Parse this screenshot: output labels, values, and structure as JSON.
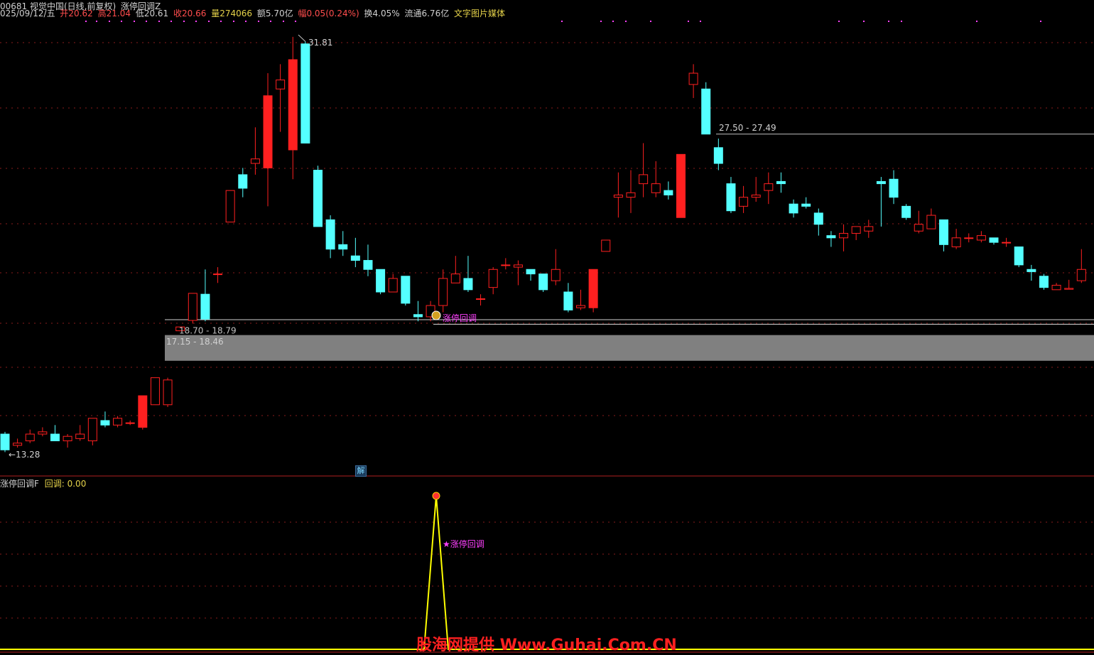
{
  "header": {
    "code_title": "00681 视觉中国(日线,前复权)",
    "indicator_name": "涨停回调Z",
    "date": "025/09/12/五",
    "open_label": "开",
    "open": "20.62",
    "high_label": "高",
    "high": "21.04",
    "low_label": "低",
    "low": "20.61",
    "close_label": "收",
    "close": "20.66",
    "volume_label": "量",
    "volume": "274066",
    "amount_label": "额",
    "amount": "5.70亿",
    "change_label": "幅",
    "change": "0.05(0.24%)",
    "turnover_label": "换",
    "turnover": "4.05%",
    "float_label": "流通",
    "float": "6.76亿",
    "tags": "文字图片媒体"
  },
  "sub_panel": {
    "name": "涨停回调F",
    "value_label": "回调:",
    "value": "0.00"
  },
  "labels": {
    "zt_pullback": "涨停回调",
    "zt_pullback_star": "★涨停回调",
    "jie": "解",
    "watermark": "股海网提供 Www.Guhai.Com.CN"
  },
  "colors": {
    "up": "#ff2020",
    "down": "#54ffff",
    "grid": "#8a1c1c",
    "zone": "#808080",
    "signal": "#ffff00",
    "magenta": "#ff40ff"
  },
  "chart_data": {
    "type": "candlestick",
    "title": "00681 视觉中国(日线,前复权)",
    "ylim": [
      12.5,
      32.5
    ],
    "annotations": [
      {
        "text": "31.81",
        "value": 31.81,
        "kind": "max"
      },
      {
        "text": "←13.28",
        "value": 13.28,
        "kind": "min"
      },
      {
        "text": "27.50 - 27.49",
        "value": 27.5,
        "kind": "level"
      },
      {
        "text": "18.70 - 18.79",
        "value": 18.79,
        "kind": "zone_top"
      },
      {
        "text": "17.15 - 18.46",
        "value": 18.46,
        "kind": "zone"
      }
    ],
    "zone": [
      17.45,
      18.59
    ],
    "support_line": 19.07,
    "candles": [
      [
        14.2,
        13.5,
        14.3,
        13.4
      ],
      [
        13.7,
        13.8,
        14.0,
        13.6
      ],
      [
        13.9,
        14.2,
        14.4,
        13.8
      ],
      [
        14.2,
        14.3,
        14.5,
        14.1
      ],
      [
        14.2,
        13.9,
        14.6,
        13.9
      ],
      [
        13.9,
        14.1,
        14.2,
        13.6
      ],
      [
        14.0,
        14.2,
        14.6,
        13.9
      ],
      [
        13.9,
        14.9,
        14.9,
        13.7
      ],
      [
        14.8,
        14.6,
        15.2,
        14.5
      ],
      [
        14.6,
        14.9,
        15.0,
        14.5
      ],
      [
        14.7,
        14.7,
        14.8,
        14.6
      ],
      [
        14.5,
        15.9,
        15.9,
        14.4
      ],
      [
        15.5,
        16.7,
        16.7,
        15.5
      ],
      [
        15.5,
        16.6,
        16.7,
        15.4
      ],
      [
        18.78,
        18.95,
        18.95,
        18.76
      ],
      [
        19.24,
        20.44,
        20.44,
        19.1
      ],
      [
        20.4,
        19.3,
        21.5,
        19.2
      ],
      [
        21.3,
        21.3,
        21.6,
        20.9
      ],
      [
        23.6,
        25.0,
        25.0,
        23.6
      ],
      [
        25.7,
        25.1,
        26.0,
        24.7
      ],
      [
        26.2,
        26.4,
        27.8,
        25.7
      ],
      [
        26.0,
        29.2,
        30.2,
        24.3
      ],
      [
        29.5,
        29.9,
        30.6,
        27.6
      ],
      [
        26.8,
        30.8,
        31.81,
        25.5
      ],
      [
        31.5,
        27.1,
        31.6,
        27.1
      ],
      [
        25.9,
        23.4,
        26.1,
        23.4
      ],
      [
        23.7,
        22.4,
        23.9,
        22.0
      ],
      [
        22.6,
        22.4,
        23.2,
        22.1
      ],
      [
        22.1,
        21.9,
        22.9,
        21.6
      ],
      [
        21.9,
        21.5,
        22.6,
        21.2
      ],
      [
        21.5,
        20.5,
        21.5,
        20.4
      ],
      [
        20.5,
        21.1,
        21.3,
        20.5
      ],
      [
        21.2,
        20.0,
        21.2,
        19.9
      ],
      [
        19.5,
        19.4,
        20.1,
        19.2
      ],
      [
        19.4,
        19.9,
        20.1,
        19.2
      ],
      [
        19.9,
        21.1,
        21.5,
        19.6
      ],
      [
        20.9,
        21.3,
        22.1,
        20.9
      ],
      [
        21.1,
        20.6,
        22.1,
        20.5
      ],
      [
        20.2,
        20.2,
        20.4,
        19.9
      ],
      [
        20.7,
        21.5,
        21.6,
        20.4
      ],
      [
        21.7,
        21.7,
        22.0,
        21.5
      ],
      [
        21.6,
        21.7,
        21.9,
        20.8
      ],
      [
        21.5,
        21.3,
        21.5,
        21.0
      ],
      [
        21.3,
        20.6,
        21.3,
        20.5
      ],
      [
        21.0,
        21.5,
        22.4,
        20.8
      ],
      [
        20.5,
        19.7,
        20.9,
        19.6
      ],
      [
        19.8,
        19.9,
        20.6,
        19.7
      ],
      [
        19.8,
        21.5,
        21.5,
        19.6
      ],
      [
        22.3,
        22.8,
        22.8,
        22.4
      ],
      [
        24.7,
        24.8,
        25.8,
        23.8
      ],
      [
        24.7,
        24.9,
        25.9,
        24.0
      ],
      [
        25.3,
        25.7,
        27.1,
        24.7
      ],
      [
        24.9,
        25.3,
        26.3,
        24.7
      ],
      [
        25.0,
        24.8,
        25.4,
        24.6
      ],
      [
        23.8,
        26.6,
        26.6,
        23.8
      ],
      [
        29.7,
        30.2,
        30.6,
        29.1
      ],
      [
        29.5,
        27.5,
        29.8,
        27.5
      ],
      [
        26.9,
        26.2,
        27.3,
        25.9
      ],
      [
        25.3,
        24.1,
        25.6,
        24.0
      ],
      [
        24.3,
        24.7,
        25.2,
        24.0
      ],
      [
        24.7,
        24.8,
        25.6,
        24.5
      ],
      [
        25.0,
        25.3,
        25.8,
        24.4
      ],
      [
        25.4,
        25.3,
        25.8,
        24.9
      ],
      [
        24.4,
        24.0,
        24.6,
        23.8
      ],
      [
        24.4,
        24.3,
        24.7,
        24.2
      ],
      [
        24.0,
        23.5,
        24.2,
        23.0
      ],
      [
        23.0,
        22.9,
        23.2,
        22.5
      ],
      [
        22.9,
        23.1,
        23.5,
        22.3
      ],
      [
        23.1,
        23.4,
        23.4,
        22.8
      ],
      [
        23.2,
        23.4,
        23.7,
        22.9
      ],
      [
        25.4,
        25.3,
        25.6,
        23.4
      ],
      [
        25.5,
        24.7,
        25.9,
        24.4
      ],
      [
        24.3,
        23.8,
        24.4,
        23.7
      ],
      [
        23.2,
        23.5,
        24.1,
        23.1
      ],
      [
        23.3,
        23.9,
        24.2,
        23.3
      ],
      [
        23.7,
        22.6,
        23.7,
        22.3
      ],
      [
        22.5,
        22.9,
        23.3,
        22.4
      ],
      [
        22.9,
        22.9,
        23.1,
        22.7
      ],
      [
        22.8,
        23.0,
        23.2,
        22.7
      ],
      [
        22.9,
        22.7,
        22.9,
        22.6
      ],
      [
        22.7,
        22.7,
        22.9,
        22.5
      ],
      [
        22.5,
        21.7,
        22.5,
        21.6
      ],
      [
        21.5,
        21.4,
        21.7,
        21.0
      ],
      [
        21.2,
        20.7,
        21.3,
        20.6
      ],
      [
        20.6,
        20.8,
        20.9,
        20.6
      ],
      [
        20.62,
        20.66,
        21.04,
        20.61
      ],
      [
        21.0,
        21.5,
        22.4,
        20.9
      ]
    ],
    "signal_series": {
      "name": "回调",
      "peak_index": 34,
      "peak_value": 1
    }
  }
}
